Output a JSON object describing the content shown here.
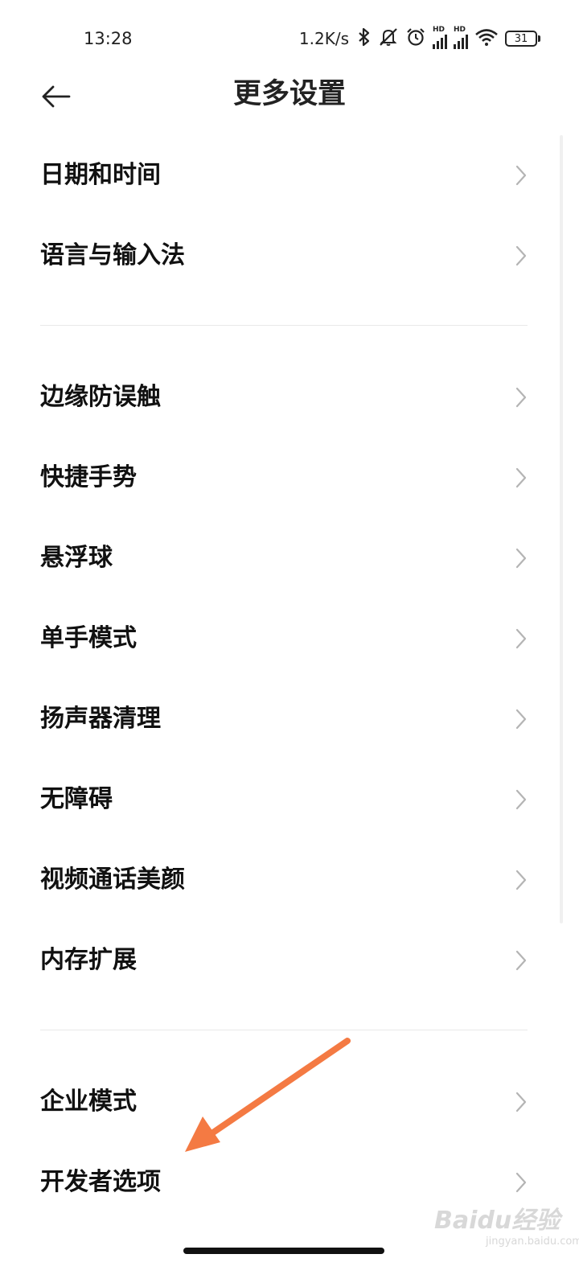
{
  "status": {
    "time": "13:28",
    "speed": "1.2K/s",
    "sim1_label": "HD",
    "sim2_label": "HD",
    "battery": "31",
    "icons": [
      "bluetooth-icon",
      "mute-icon",
      "alarm-icon",
      "signal-icon",
      "signal-icon",
      "wifi-icon",
      "battery-icon"
    ]
  },
  "header": {
    "title": "更多设置",
    "back_icon": "back-arrow-icon"
  },
  "groups": [
    {
      "items": [
        {
          "label": "日期和时间"
        },
        {
          "label": "语言与输入法"
        }
      ]
    },
    {
      "items": [
        {
          "label": "边缘防误触"
        },
        {
          "label": "快捷手势"
        },
        {
          "label": "悬浮球"
        },
        {
          "label": "单手模式"
        },
        {
          "label": "扬声器清理"
        },
        {
          "label": "无障碍"
        },
        {
          "label": "视频通话美颜"
        },
        {
          "label": "内存扩展"
        }
      ]
    },
    {
      "items": [
        {
          "label": "企业模式"
        },
        {
          "label": "开发者选项"
        }
      ]
    }
  ],
  "annotation": {
    "arrow_color": "#f47a43"
  },
  "watermark": {
    "brand": "Baidu经验",
    "url": "jingyan.baidu.com"
  }
}
